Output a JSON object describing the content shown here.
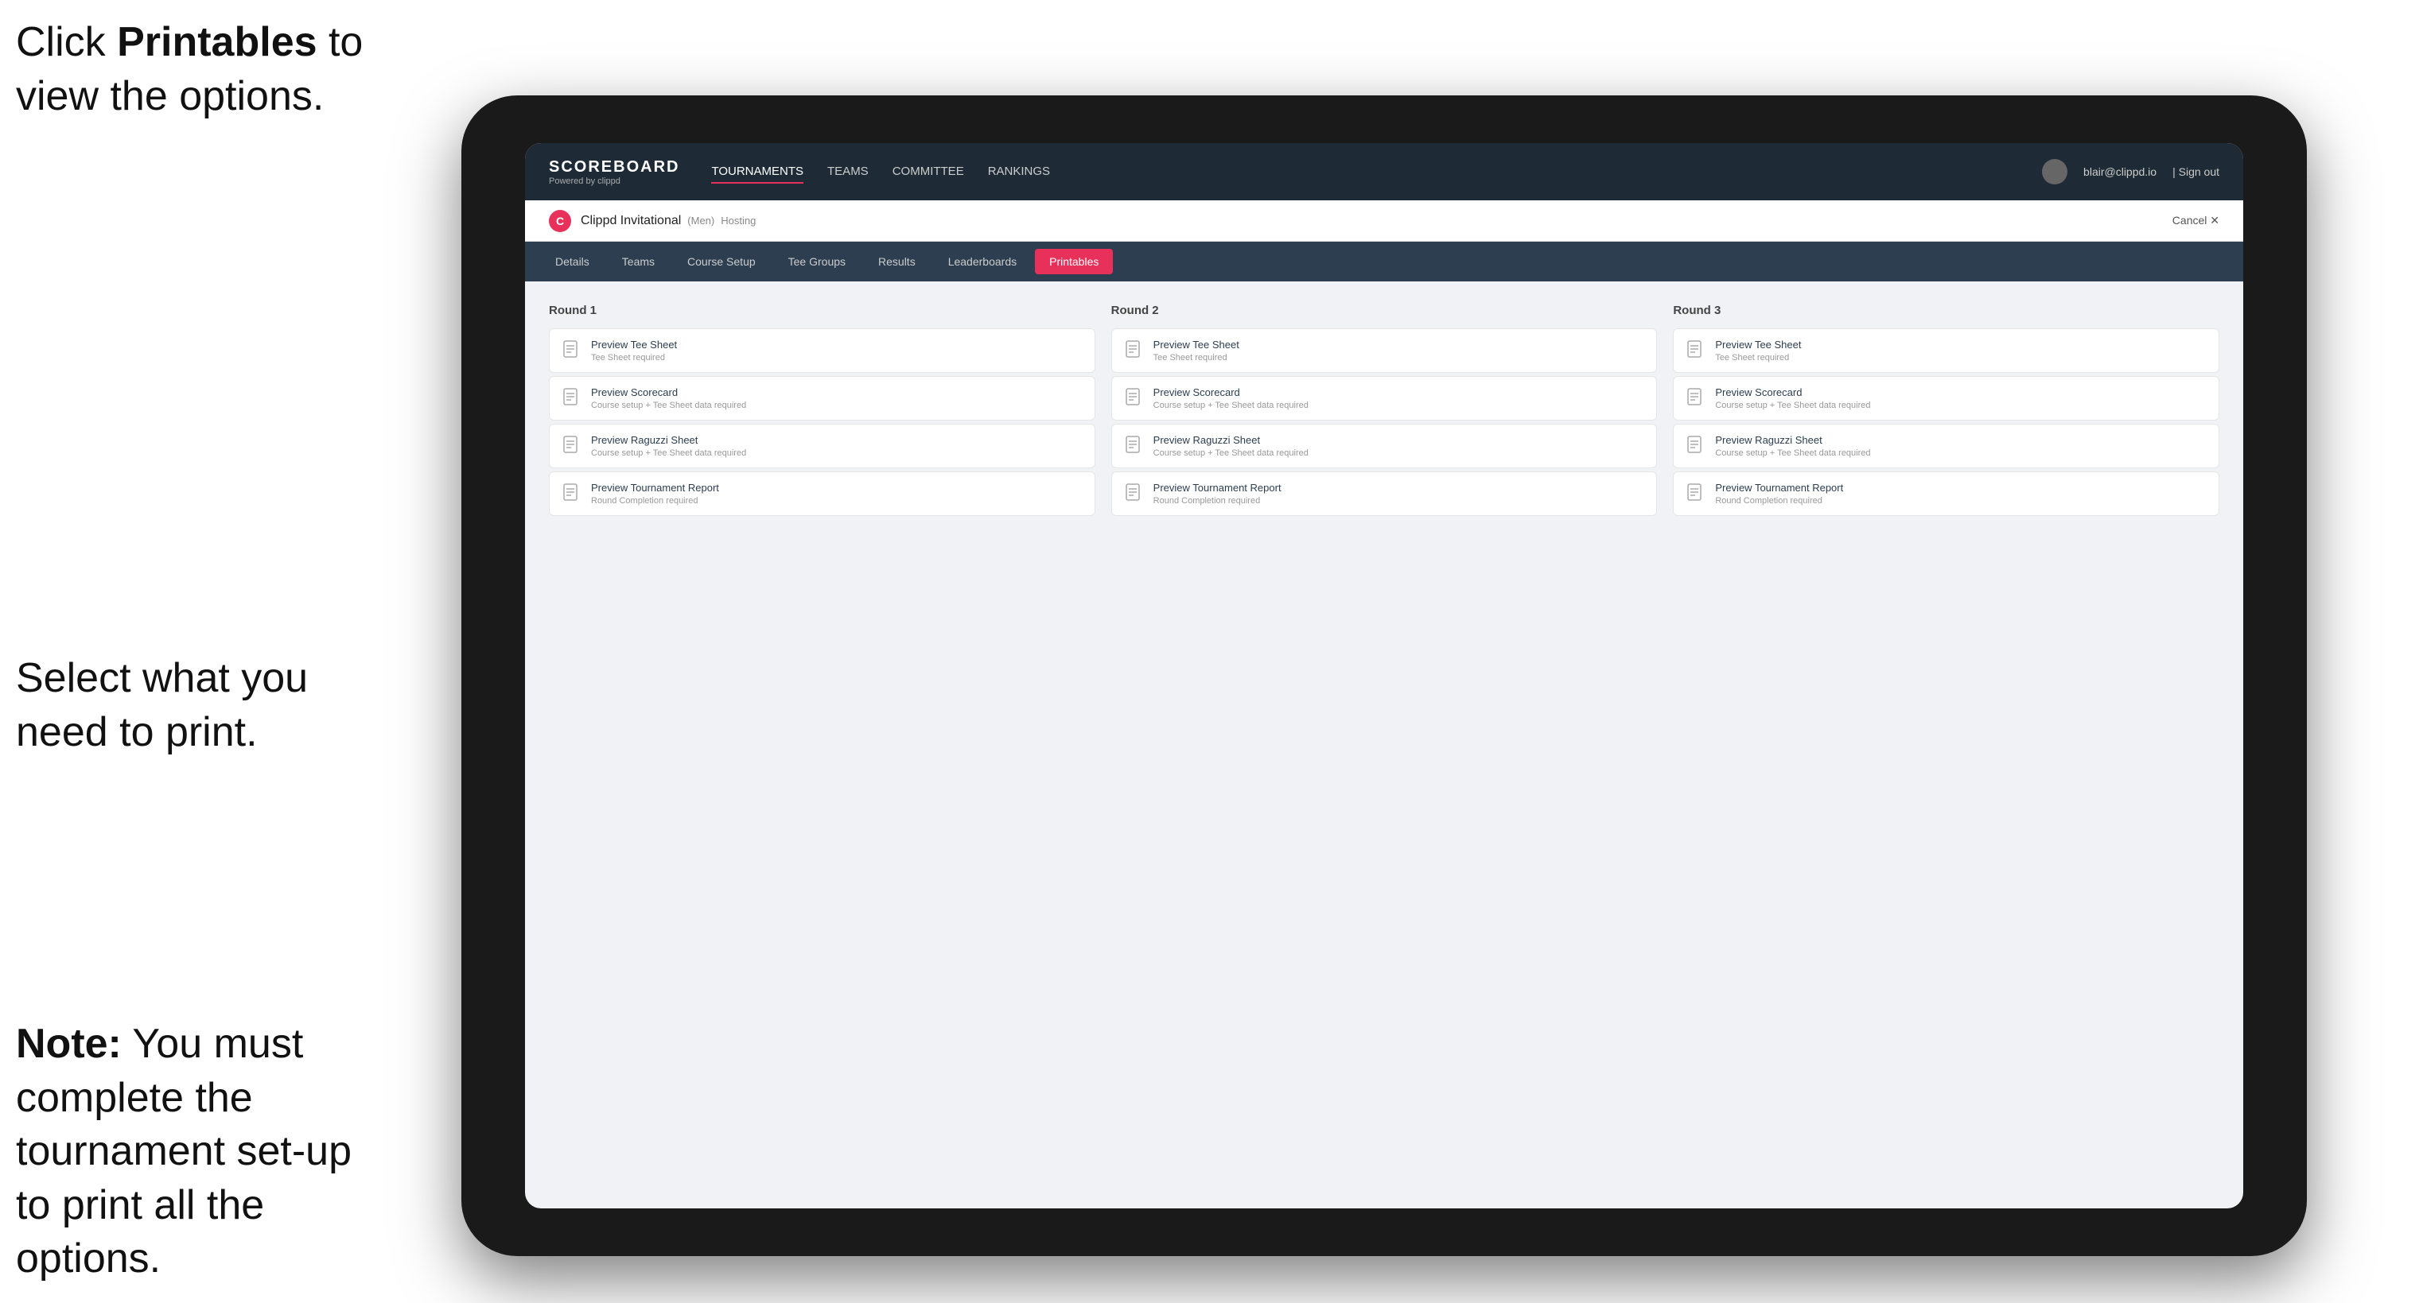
{
  "annotations": {
    "top": "Click ",
    "top_bold": "Printables",
    "top_rest": " to view the options.",
    "middle": "Select what you need to print.",
    "bottom_bold": "Note:",
    "bottom_rest": " You must complete the tournament set-up to print all the options."
  },
  "topNav": {
    "logo": "SCOREBOARD",
    "logo_sub": "Powered by clippd",
    "links": [
      "TOURNAMENTS",
      "TEAMS",
      "COMMITTEE",
      "RANKINGS"
    ],
    "active_link": "TOURNAMENTS",
    "user_email": "blair@clippd.io",
    "sign_out": "Sign out"
  },
  "tournament": {
    "logo_letter": "C",
    "name": "Clippd Invitational",
    "type": "(Men)",
    "status": "Hosting",
    "cancel_label": "Cancel ✕"
  },
  "subNav": {
    "tabs": [
      "Details",
      "Teams",
      "Course Setup",
      "Tee Groups",
      "Results",
      "Leaderboards",
      "Printables"
    ],
    "active_tab": "Printables"
  },
  "rounds": [
    {
      "label": "Round 1",
      "cards": [
        {
          "title": "Preview Tee Sheet",
          "subtitle": "Tee Sheet required"
        },
        {
          "title": "Preview Scorecard",
          "subtitle": "Course setup + Tee Sheet data required"
        },
        {
          "title": "Preview Raguzzi Sheet",
          "subtitle": "Course setup + Tee Sheet data required"
        },
        {
          "title": "Preview Tournament Report",
          "subtitle": "Round Completion required"
        }
      ]
    },
    {
      "label": "Round 2",
      "cards": [
        {
          "title": "Preview Tee Sheet",
          "subtitle": "Tee Sheet required"
        },
        {
          "title": "Preview Scorecard",
          "subtitle": "Course setup + Tee Sheet data required"
        },
        {
          "title": "Preview Raguzzi Sheet",
          "subtitle": "Course setup + Tee Sheet data required"
        },
        {
          "title": "Preview Tournament Report",
          "subtitle": "Round Completion required"
        }
      ]
    },
    {
      "label": "Round 3",
      "cards": [
        {
          "title": "Preview Tee Sheet",
          "subtitle": "Tee Sheet required"
        },
        {
          "title": "Preview Scorecard",
          "subtitle": "Course setup + Tee Sheet data required"
        },
        {
          "title": "Preview Raguzzi Sheet",
          "subtitle": "Course setup + Tee Sheet data required"
        },
        {
          "title": "Preview Tournament Report",
          "subtitle": "Round Completion required"
        }
      ]
    }
  ]
}
